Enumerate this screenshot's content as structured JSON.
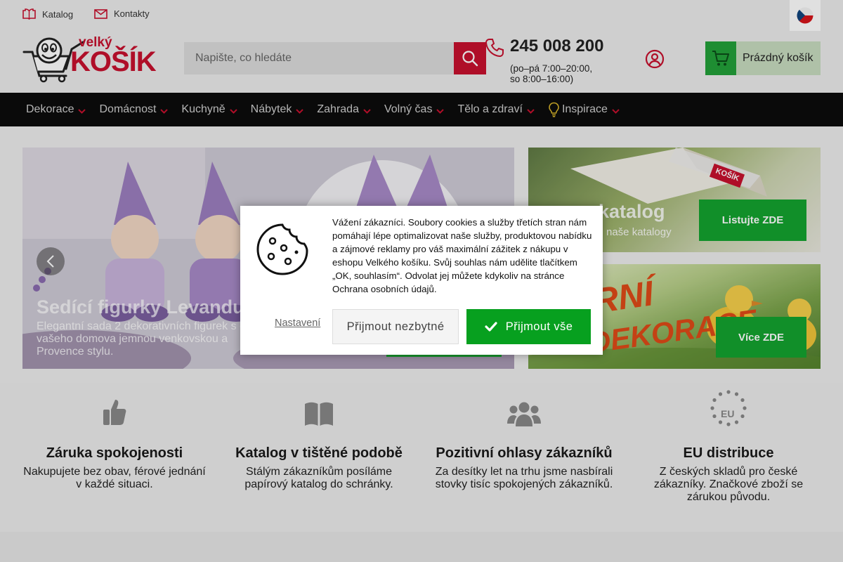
{
  "topbar": {
    "catalog_link": "Katalog",
    "contacts_link": "Kontakty"
  },
  "header": {
    "logo_small": "velký",
    "logo_big": "KOŠÍK",
    "search_placeholder": "Napište, co hledáte",
    "phone_number": "245 008 200",
    "phone_hours_line1": "(po–pá 7:00–20:00,",
    "phone_hours_line2": "so 8:00–16:00)",
    "cart_label": "Prázdný košík"
  },
  "nav": {
    "items": [
      "Dekorace",
      "Domácnost",
      "Kuchyně",
      "Nábytek",
      "Zahrada",
      "Volný čas",
      "Tělo a zdraví",
      "Inspirace"
    ]
  },
  "hero": {
    "title": "Sedící figurky Levandu",
    "description": "Elegantní sada 2 dekorativních figurek s do vašeho domova jemnou venkovskou a Provence stylu."
  },
  "promos": {
    "catalog_title": "katalog",
    "catalog_sub": "naše katalogy",
    "catalog_button": "Listujte ZDE",
    "catalog_image_text": "KOŠÍK",
    "easter_image_text_1": "RNÍ",
    "easter_image_text_2": "DEKORACE",
    "easter_button": "Více ZDE"
  },
  "features": [
    {
      "icon": "thumbs-up-icon",
      "title": "Záruka spokojenosti",
      "text_1": "Nakupujete bez obav, férové jednání",
      "text_2": "v každé situaci."
    },
    {
      "icon": "book-icon",
      "title": "Katalog v tištěné podobě",
      "text_1": "Stálým zákazníkům posíláme",
      "text_2": "papírový katalog do schránky."
    },
    {
      "icon": "users-icon",
      "title": "Pozitivní ohlasy zákazníků",
      "text_1": "Za desítky let na trhu jsme nasbírali",
      "text_2": "stovky tisíc spokojených zákazníků."
    },
    {
      "icon": "eu-stars-icon",
      "title": "EU distribuce",
      "text_1": "Z českých skladů pro české",
      "text_2": "zákazníky. Značkové zboží se",
      "text_3": "zárukou původu."
    }
  ],
  "eu_label": "EU",
  "cookie": {
    "text": "Vážení zákazníci. Soubory cookies a služby třetích stran nám pomáhají lépe optimalizovat naše služby, produktovou nabídku a zájmové reklamy pro váš maximální zážitek z nákupu v eshopu Velkého košíku. Svůj souhlas nám udělite tlačítkem „OK, souhlasím“. Odvolat jej můžete kdykoliv na stránce Ochrana osobních údajů.",
    "settings_link": "Nastavení",
    "necessary_button": "Přijmout nezbytné",
    "accept_all_button": "Přijmout vše"
  },
  "colors": {
    "brand_red": "#c8102e",
    "accent_green": "#07a01f",
    "nav_bg": "#0c0c0c"
  }
}
